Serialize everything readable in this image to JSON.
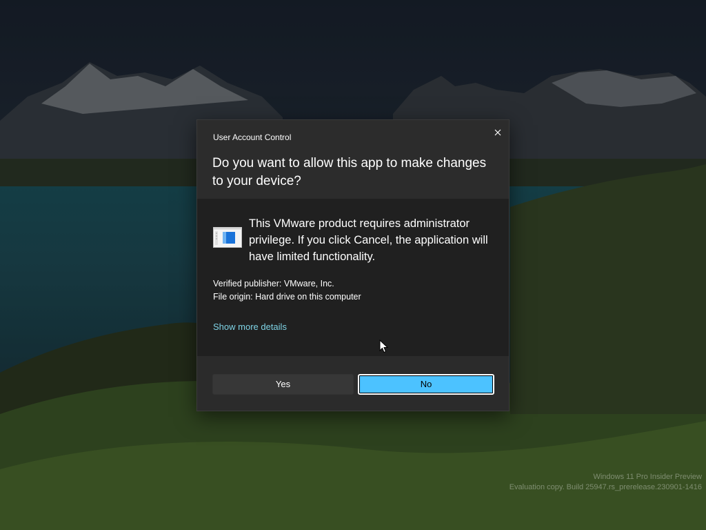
{
  "dialog": {
    "title": "User Account Control",
    "question": "Do you want to allow this app to make changes to your device?",
    "description": "This VMware product requires administrator privilege. If you click Cancel, the application will have limited functionality.",
    "publisher": "Verified publisher: VMware, Inc.",
    "file_origin": "File origin: Hard drive on this computer",
    "more_details_link": "Show more details",
    "yes_label": "Yes",
    "no_label": "No"
  },
  "watermark": {
    "line1": "Windows 11 Pro Insider Preview",
    "line2": "Evaluation copy. Build 25947.rs_prerelease.230901-1416"
  },
  "colors": {
    "accent": "#4cc2ff",
    "link": "#7fd4e6",
    "dialog_header": "#2c2c2c",
    "dialog_body": "#202020"
  },
  "icons": {
    "close": "close-icon",
    "app": "application-window-icon"
  }
}
